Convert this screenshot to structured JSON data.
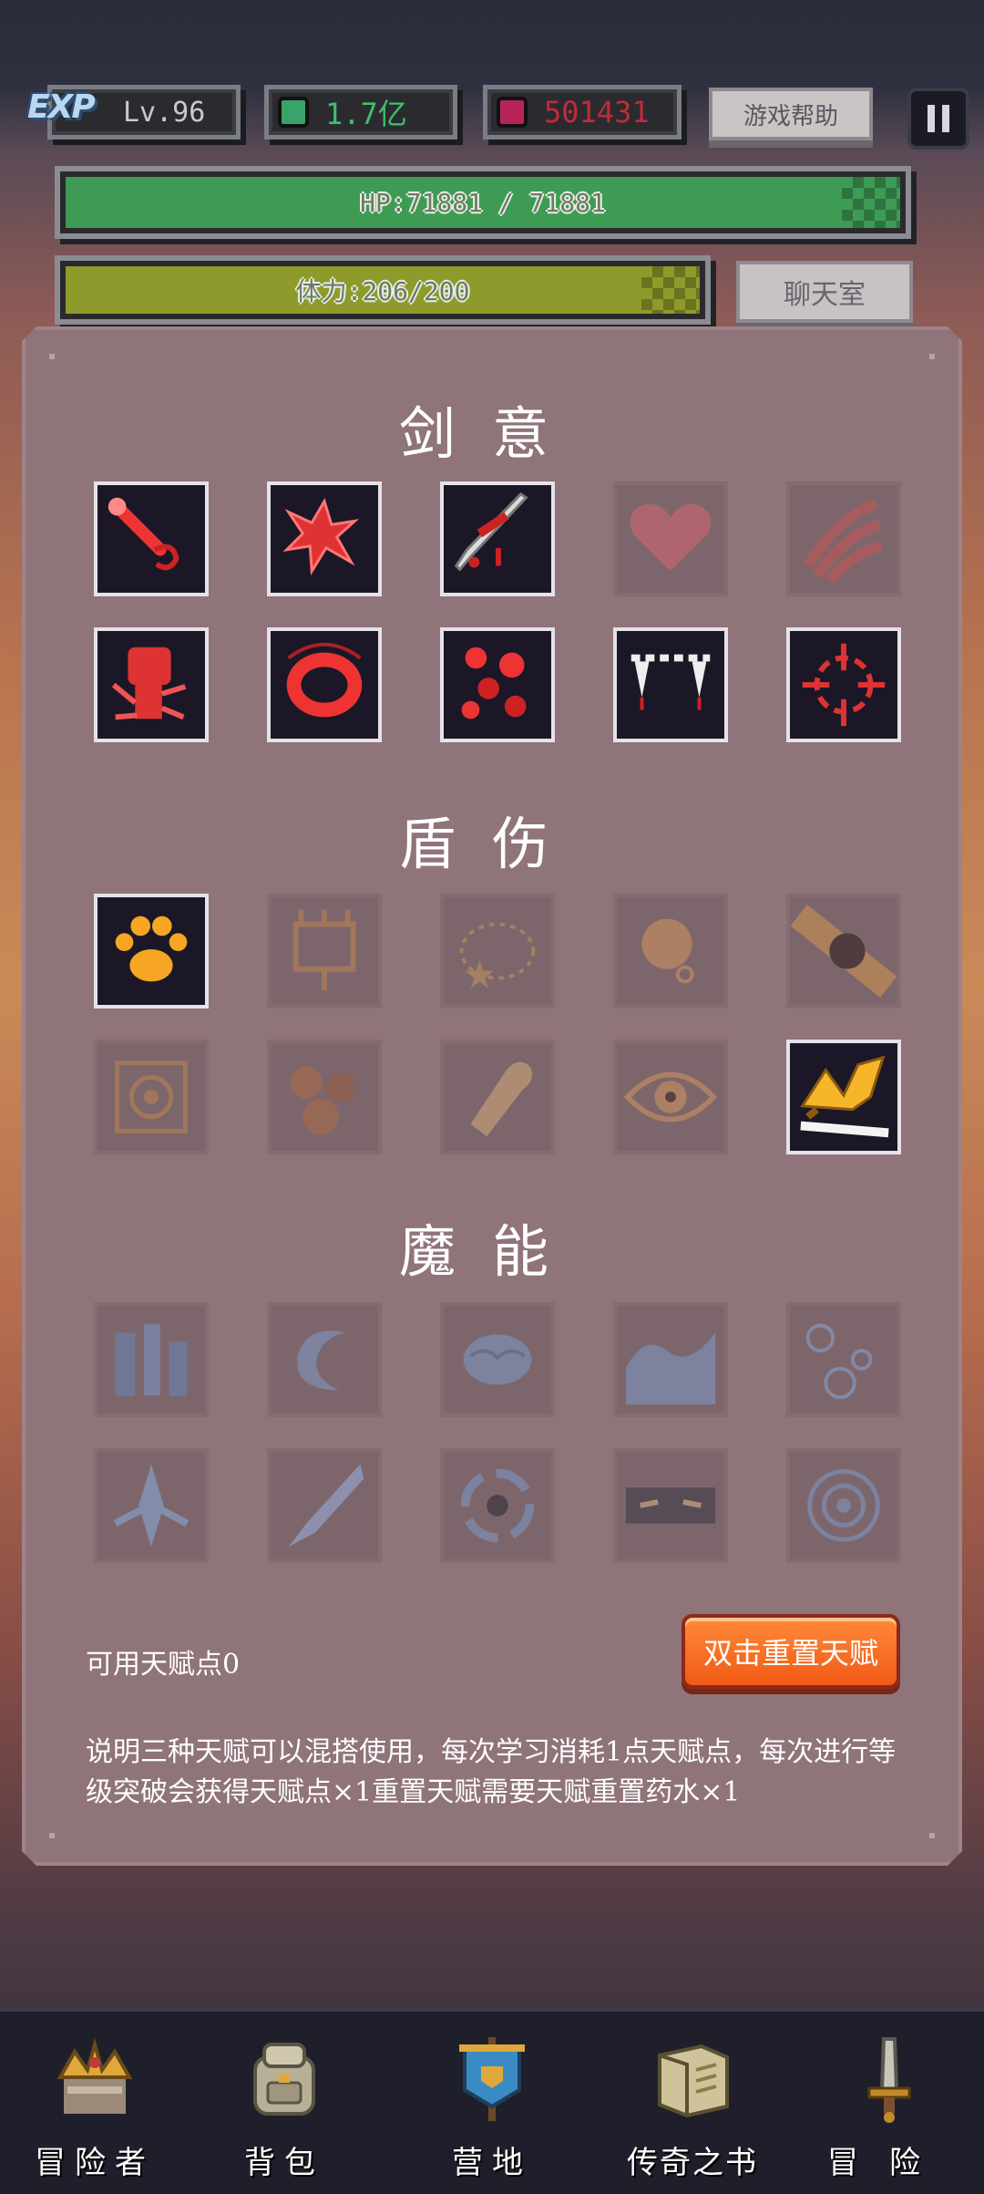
{
  "hud": {
    "exp_logo": "EXP",
    "level": "Lv.96",
    "green_currency": "1.7亿",
    "red_currency": "501431",
    "help_button": "游戏帮助",
    "pause_icon": "pause-icon"
  },
  "hp_bar": {
    "label": "HP:71881 / 71881",
    "fraction": 1.0,
    "color": "#3e9b54"
  },
  "stamina_bar": {
    "label": "体力:206/200",
    "fraction": 1.0,
    "color": "#8f9a2c"
  },
  "chat_button": "聊天室",
  "talents": {
    "sections": [
      {
        "title": "剑意",
        "slots": [
          {
            "icon": "blood-sword-icon",
            "active": true
          },
          {
            "icon": "blood-splat-icon",
            "active": true
          },
          {
            "icon": "bleeding-blade-icon",
            "active": true
          },
          {
            "icon": "heart-icon",
            "active": false
          },
          {
            "icon": "claw-slash-icon",
            "active": false
          },
          {
            "icon": "fist-icon",
            "active": true
          },
          {
            "icon": "blood-ring-icon",
            "active": true
          },
          {
            "icon": "blood-drops-icon",
            "active": true
          },
          {
            "icon": "fangs-icon",
            "active": true
          },
          {
            "icon": "crosshair-icon",
            "active": true
          }
        ]
      },
      {
        "title": "盾伤",
        "slots": [
          {
            "icon": "paw-icon",
            "active": true
          },
          {
            "icon": "shield-totem-icon",
            "active": false
          },
          {
            "icon": "star-ring-icon",
            "active": false
          },
          {
            "icon": "bell-icon",
            "active": false
          },
          {
            "icon": "cannonball-icon",
            "active": false
          },
          {
            "icon": "target-rune-icon",
            "active": false
          },
          {
            "icon": "rocks-icon",
            "active": false
          },
          {
            "icon": "bullet-icon",
            "active": false
          },
          {
            "icon": "eye-icon",
            "active": false
          },
          {
            "icon": "thunder-blade-icon",
            "active": true
          }
        ]
      },
      {
        "title": "魔能",
        "slots": [
          {
            "icon": "potion-bottles-icon",
            "active": false
          },
          {
            "icon": "crescent-icon",
            "active": false
          },
          {
            "icon": "brain-icon",
            "active": false
          },
          {
            "icon": "wave-icon",
            "active": false
          },
          {
            "icon": "bubbles-icon",
            "active": false
          },
          {
            "icon": "ice-shard-icon",
            "active": false
          },
          {
            "icon": "ice-spike-icon",
            "active": false
          },
          {
            "icon": "vortex-icon",
            "active": false
          },
          {
            "icon": "shadow-eyes-icon",
            "active": false
          },
          {
            "icon": "portal-icon",
            "active": false
          }
        ]
      }
    ],
    "available_points": "可用天赋点0",
    "reset_button": "双击重置天赋",
    "description": "说明三种天赋可以混搭使用，每次学习消耗1点天赋点，每次进行等级突破会获得天赋点×1重置天赋需要天赋重置药水×1"
  },
  "nav": [
    {
      "label": "冒险者",
      "icon": "crown-icon"
    },
    {
      "label": "背包",
      "icon": "backpack-icon"
    },
    {
      "label": "营地",
      "icon": "camp-banner-icon"
    },
    {
      "label": "传奇之书",
      "icon": "book-icon"
    },
    {
      "label": "冒险",
      "icon": "sword-icon"
    }
  ]
}
